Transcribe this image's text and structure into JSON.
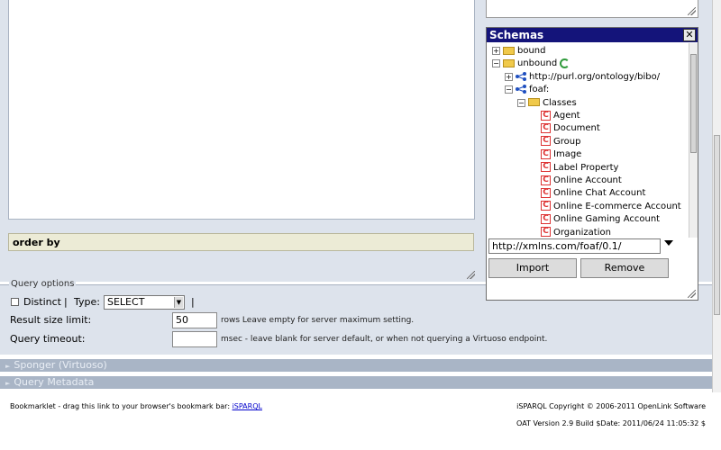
{
  "schemas": {
    "title": "Schemas",
    "close": "✕",
    "tree": [
      {
        "label": "bound",
        "kind": "folder",
        "toggle": "+",
        "depth": 0
      },
      {
        "label": "unbound",
        "kind": "folder",
        "toggle": "−",
        "depth": 0,
        "sync": true
      },
      {
        "label": "http://purl.org/ontology/bibo/",
        "kind": "ns",
        "toggle": "+",
        "depth": 1
      },
      {
        "label": "foaf:",
        "kind": "ns",
        "toggle": "−",
        "depth": 1
      },
      {
        "label": "Classes",
        "kind": "folder",
        "toggle": "−",
        "depth": 2
      },
      {
        "label": "Agent",
        "kind": "class",
        "depth": 3
      },
      {
        "label": "Document",
        "kind": "class",
        "depth": 3
      },
      {
        "label": "Group",
        "kind": "class",
        "depth": 3
      },
      {
        "label": "Image",
        "kind": "class",
        "depth": 3
      },
      {
        "label": "Label Property",
        "kind": "class",
        "depth": 3
      },
      {
        "label": "Online Account",
        "kind": "class",
        "depth": 3
      },
      {
        "label": "Online Chat Account",
        "kind": "class",
        "depth": 3
      },
      {
        "label": "Online E-commerce Account",
        "kind": "class",
        "depth": 3
      },
      {
        "label": "Online Gaming Account",
        "kind": "class",
        "depth": 3
      },
      {
        "label": "Organization",
        "kind": "class",
        "depth": 3
      }
    ],
    "namespace_value": "http://xmlns.com/foaf/0.1/",
    "import_label": "Import",
    "remove_label": "Remove"
  },
  "order_by_label": "order by",
  "query_options": {
    "legend": "Query options",
    "distinct_label": "Distinct",
    "type_label": "Type:",
    "type_value": "SELECT",
    "sep": "|",
    "result_limit_label": "Result size limit:",
    "result_limit_value": "50",
    "result_limit_hint": "rows Leave empty for server maximum setting.",
    "timeout_label": "Query timeout:",
    "timeout_value": "",
    "timeout_hint": "msec - leave blank for server default, or when not querying a Virtuoso endpoint."
  },
  "sections": {
    "sponger": "Sponger (Virtuoso)",
    "metadata": "Query Metadata"
  },
  "footer": {
    "bookmarklet_text": "Bookmarklet - drag this link to your browser's bookmark bar:",
    "bookmarklet_link": "iSPARQL",
    "copyright": "iSPARQL Copyright © 2006-2011 OpenLink Software",
    "version": "OAT Version 2.9 Build $Date: 2011/06/24 11:05:32 $"
  }
}
